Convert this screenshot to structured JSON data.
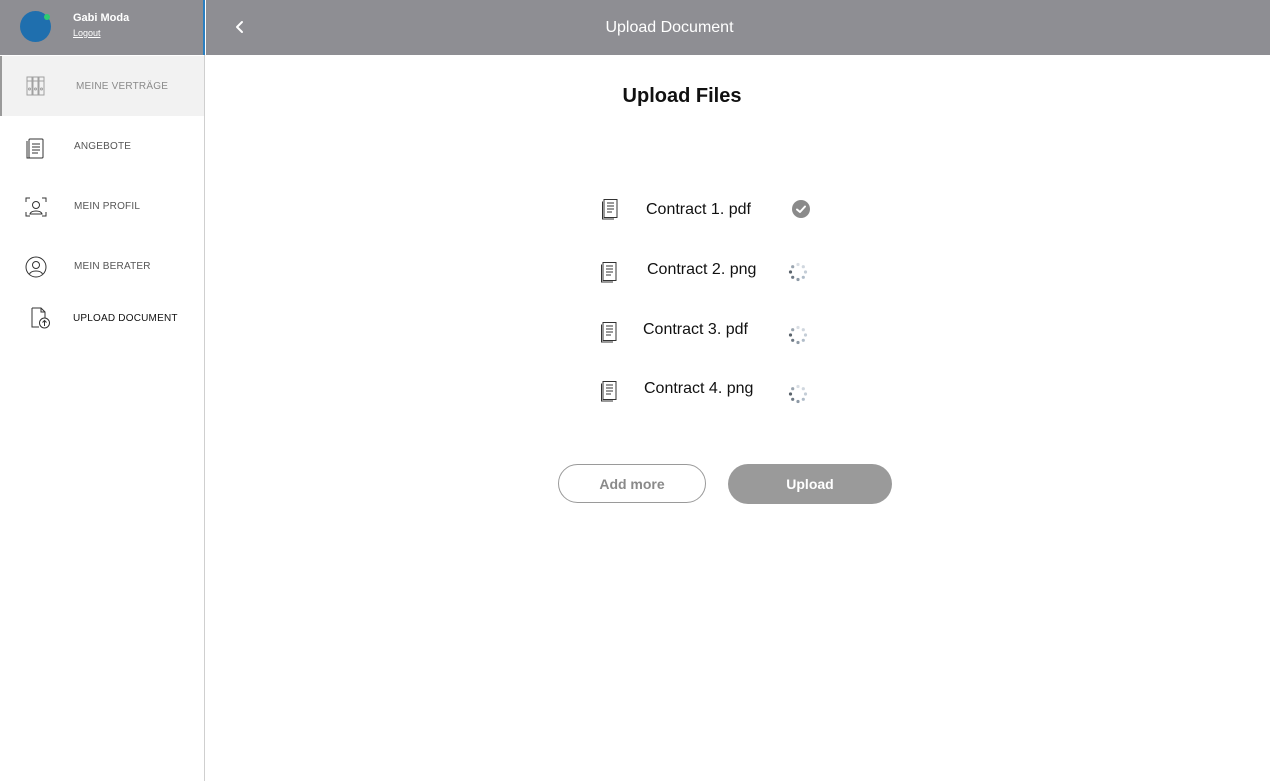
{
  "user": {
    "name": "Gabi Moda",
    "logout_label": "Logout",
    "avatar_color": "#1f6fae",
    "status_color": "#2ecc71"
  },
  "sidebar": {
    "items": [
      {
        "label": "MEINE VERTRÄGE",
        "icon": "binders-icon",
        "state": "active"
      },
      {
        "label": "ANGEBOTE",
        "icon": "document-list-icon",
        "state": "default"
      },
      {
        "label": "MEIN PROFIL",
        "icon": "profile-scan-icon",
        "state": "default"
      },
      {
        "label": "MEIN BERATER",
        "icon": "advisor-icon",
        "state": "default"
      },
      {
        "label": "UPLOAD DOCUMENT",
        "icon": "upload-document-icon",
        "state": "current"
      }
    ]
  },
  "header": {
    "title": "Upload Document",
    "back_icon": "chevron-left-icon",
    "bar_color": "#8e8e93"
  },
  "main": {
    "title": "Upload Files",
    "files": [
      {
        "name": "Contract 1. pdf",
        "status": "uploaded",
        "status_icon": "check-circle-icon"
      },
      {
        "name": "Contract 2. png",
        "status": "uploading",
        "status_icon": "spinner-icon"
      },
      {
        "name": "Contract 3. pdf",
        "status": "uploading",
        "status_icon": "spinner-icon"
      },
      {
        "name": "Contract 4. png",
        "status": "uploading",
        "status_icon": "spinner-icon"
      }
    ],
    "add_more_label": "Add more",
    "upload_label": "Upload"
  }
}
